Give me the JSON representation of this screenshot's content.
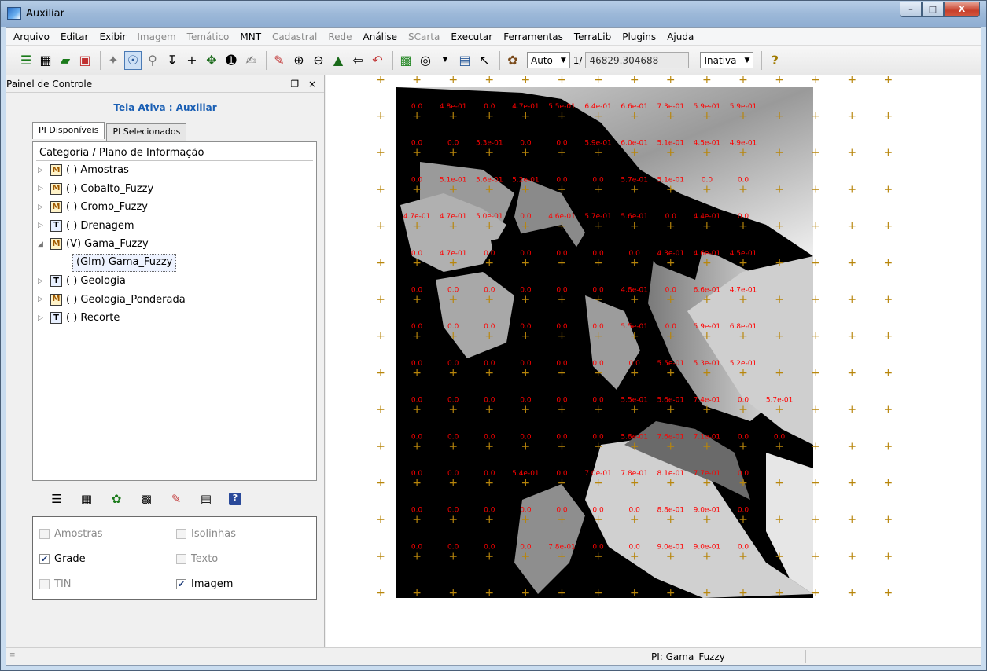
{
  "window": {
    "title": "Auxiliar",
    "minimize": "–",
    "maximize": "□",
    "close": "X"
  },
  "menu": [
    {
      "label": "Arquivo",
      "enabled": true
    },
    {
      "label": "Editar",
      "enabled": true
    },
    {
      "label": "Exibir",
      "enabled": true
    },
    {
      "label": "Imagem",
      "enabled": false
    },
    {
      "label": "Temático",
      "enabled": false
    },
    {
      "label": "MNT",
      "enabled": true
    },
    {
      "label": "Cadastral",
      "enabled": false
    },
    {
      "label": "Rede",
      "enabled": false
    },
    {
      "label": "Análise",
      "enabled": true
    },
    {
      "label": "SCarta",
      "enabled": false
    },
    {
      "label": "Executar",
      "enabled": true
    },
    {
      "label": "Ferramentas",
      "enabled": true
    },
    {
      "label": "TerraLib",
      "enabled": true
    },
    {
      "label": "Plugins",
      "enabled": true
    },
    {
      "label": "Ajuda",
      "enabled": true
    }
  ],
  "toolbar": {
    "scale_mode": "Auto",
    "scale_prefix": "1/",
    "scale_value": "46829.304688",
    "state_select": "Inativa"
  },
  "panel": {
    "title": "Painel de Controle",
    "controls": "❐ ×",
    "active_screen": "Tela Ativa : Auxiliar",
    "tabs": [
      "PI Disponíveis",
      "PI Selecionados"
    ],
    "tree_header": "Categoria / Plano de Informação",
    "layers": [
      {
        "type": "M",
        "label": "( ) Amostras",
        "expanded": false
      },
      {
        "type": "M",
        "label": "( ) Cobalto_Fuzzy",
        "expanded": false
      },
      {
        "type": "M",
        "label": "( ) Cromo_Fuzzy",
        "expanded": false
      },
      {
        "type": "T",
        "label": "( ) Drenagem",
        "expanded": false
      },
      {
        "type": "M",
        "label": "(V) Gama_Fuzzy",
        "expanded": true,
        "child": "(GIm) Gama_Fuzzy"
      },
      {
        "type": "T",
        "label": "( ) Geologia",
        "expanded": false
      },
      {
        "type": "M",
        "label": "( ) Geologia_Ponderada",
        "expanded": false
      },
      {
        "type": "T",
        "label": "( ) Recorte",
        "expanded": false
      }
    ],
    "checkboxes": [
      {
        "label": "Amostras",
        "checked": false,
        "enabled": false
      },
      {
        "label": "Isolinhas",
        "checked": false,
        "enabled": false
      },
      {
        "label": "Grade",
        "checked": true,
        "enabled": true
      },
      {
        "label": "Texto",
        "checked": false,
        "enabled": false
      },
      {
        "label": "TIN",
        "checked": false,
        "enabled": false
      },
      {
        "label": "Imagem",
        "checked": true,
        "enabled": true
      }
    ]
  },
  "map": {
    "grid_labels": [
      [
        "0.0",
        "4.8e-01",
        "0.0",
        "4.7e-01",
        "5.5e-01",
        "6.4e-01",
        "6.6e-01",
        "7.3e-01",
        "5.9e-01",
        "5.9e-01"
      ],
      [
        "0.0",
        "0.0",
        "5.3e-01",
        "0.0",
        "0.0",
        "5.9e-01",
        "6.0e-01",
        "5.1e-01",
        "4.5e-01",
        "4.9e-01"
      ],
      [
        "0.0",
        "5.1e-01",
        "5.6e-01",
        "5.2e-01",
        "0.0",
        "0.0",
        "5.7e-01",
        "5.1e-01",
        "0.0",
        "0.0"
      ],
      [
        "4.7e-01",
        "4.7e-01",
        "5.0e-01",
        "0.0",
        "4.6e-01",
        "5.7e-01",
        "5.6e-01",
        "0.0",
        "4.4e-01",
        "0.0"
      ],
      [
        "0.0",
        "4.7e-01",
        "0.0",
        "0.0",
        "0.0",
        "0.0",
        "0.0",
        "4.3e-01",
        "4.6e-01",
        "4.5e-01"
      ],
      [
        "0.0",
        "0.0",
        "0.0",
        "0.0",
        "0.0",
        "0.0",
        "4.8e-01",
        "0.0",
        "6.6e-01",
        "4.7e-01"
      ],
      [
        "0.0",
        "0.0",
        "0.0",
        "0.0",
        "0.0",
        "0.0",
        "5.5e-01",
        "0.0",
        "5.9e-01",
        "6.8e-01"
      ],
      [
        "0.0",
        "0.0",
        "0.0",
        "0.0",
        "0.0",
        "0.0",
        "0.0",
        "5.5e-01",
        "5.3e-01",
        "5.2e-01"
      ],
      [
        "0.0",
        "0.0",
        "0.0",
        "0.0",
        "0.0",
        "0.0",
        "5.5e-01",
        "5.6e-01",
        "7.4e-01",
        "0.0",
        "5.7e-01"
      ],
      [
        "0.0",
        "0.0",
        "0.0",
        "0.0",
        "0.0",
        "0.0",
        "5.8e-01",
        "7.6e-01",
        "7.1e-01",
        "0.0",
        "0.0"
      ],
      [
        "0.0",
        "0.0",
        "0.0",
        "5.4e-01",
        "0.0",
        "7.0e-01",
        "7.8e-01",
        "8.1e-01",
        "7.7e-01",
        "0.0"
      ],
      [
        "0.0",
        "0.0",
        "0.0",
        "0.0",
        "0.0",
        "0.0",
        "0.0",
        "8.8e-01",
        "9.0e-01",
        "0.0"
      ],
      [
        "0.0",
        "0.0",
        "0.0",
        "0.0",
        "7.8e-01",
        "0.0",
        "0.0",
        "9.0e-01",
        "9.0e-01",
        "0.0"
      ]
    ],
    "label_color": "#ff0000",
    "cross_color": "#b8860b"
  },
  "status": {
    "pi_label": "PI: Gama_Fuzzy"
  }
}
